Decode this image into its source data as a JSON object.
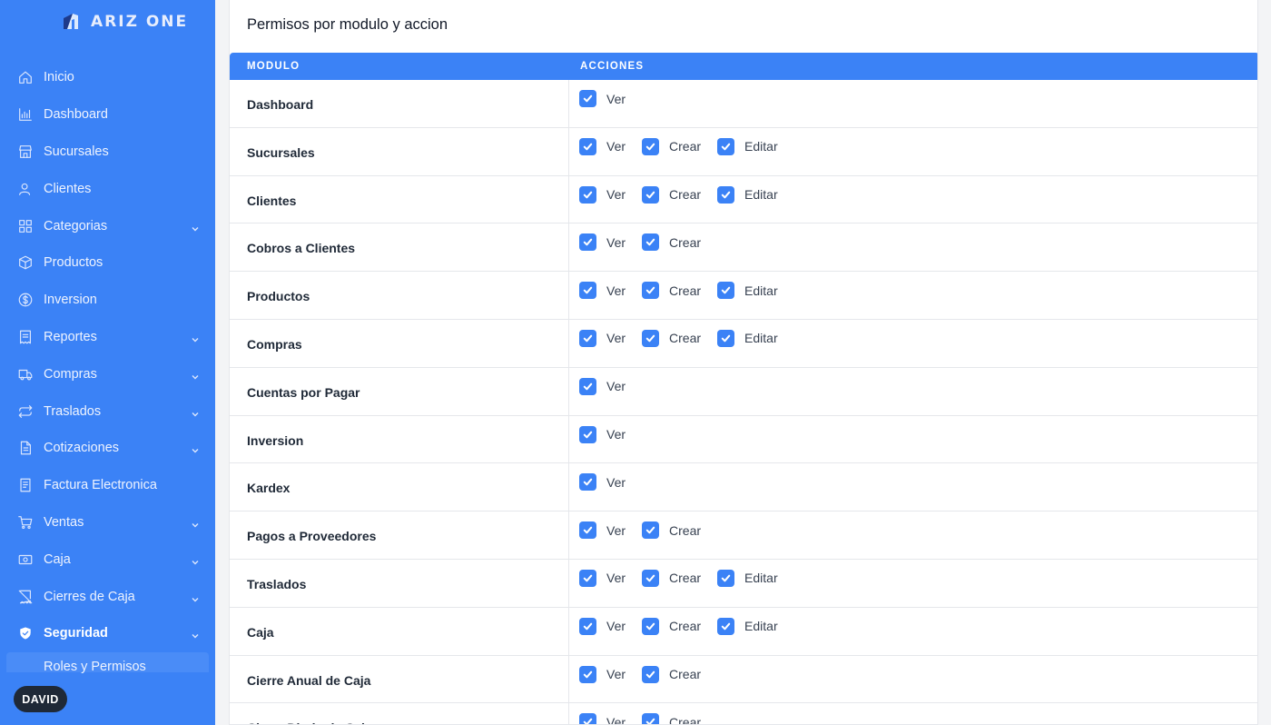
{
  "app": {
    "brand": "ARIZ ONE"
  },
  "sidebar": {
    "items": [
      {
        "label": "Inicio",
        "icon": "home-icon",
        "chevron": false
      },
      {
        "label": "Dashboard",
        "icon": "chart-icon",
        "chevron": false
      },
      {
        "label": "Sucursales",
        "icon": "store-icon",
        "chevron": false
      },
      {
        "label": "Clientes",
        "icon": "users-icon",
        "chevron": false
      },
      {
        "label": "Categorias",
        "icon": "grid-icon",
        "chevron": true
      },
      {
        "label": "Productos",
        "icon": "box-icon",
        "chevron": false
      },
      {
        "label": "Inversion",
        "icon": "dollar-icon",
        "chevron": false
      },
      {
        "label": "Reportes",
        "icon": "receipt-icon",
        "chevron": true
      },
      {
        "label": "Compras",
        "icon": "truck-icon",
        "chevron": true
      },
      {
        "label": "Traslados",
        "icon": "transfer-icon",
        "chevron": true
      },
      {
        "label": "Cotizaciones",
        "icon": "document-icon",
        "chevron": true
      },
      {
        "label": "Factura Electronica",
        "icon": "invoice-icon",
        "chevron": false
      },
      {
        "label": "Ventas",
        "icon": "cart-icon",
        "chevron": true
      },
      {
        "label": "Caja",
        "icon": "cash-icon",
        "chevron": true
      },
      {
        "label": "Cierres de Caja",
        "icon": "receipt-off-icon",
        "chevron": true
      },
      {
        "label": "Seguridad",
        "icon": "shield-icon",
        "chevron": true,
        "active": true
      }
    ],
    "sub_item": "Roles y Permisos",
    "user": "DAVID"
  },
  "main": {
    "title": "Permisos por modulo y accion",
    "columns": [
      "MODULO",
      "ACCIONES"
    ],
    "rows": [
      {
        "module": "Dashboard",
        "actions": [
          "Ver"
        ]
      },
      {
        "module": "Sucursales",
        "actions": [
          "Ver",
          "Crear",
          "Editar"
        ]
      },
      {
        "module": "Clientes",
        "actions": [
          "Ver",
          "Crear",
          "Editar"
        ]
      },
      {
        "module": "Cobros a Clientes",
        "actions": [
          "Ver",
          "Crear"
        ]
      },
      {
        "module": "Productos",
        "actions": [
          "Ver",
          "Crear",
          "Editar"
        ]
      },
      {
        "module": "Compras",
        "actions": [
          "Ver",
          "Crear",
          "Editar"
        ]
      },
      {
        "module": "Cuentas por Pagar",
        "actions": [
          "Ver"
        ]
      },
      {
        "module": "Inversion",
        "actions": [
          "Ver"
        ]
      },
      {
        "module": "Kardex",
        "actions": [
          "Ver"
        ]
      },
      {
        "module": "Pagos a Proveedores",
        "actions": [
          "Ver",
          "Crear"
        ]
      },
      {
        "module": "Traslados",
        "actions": [
          "Ver",
          "Crear",
          "Editar"
        ]
      },
      {
        "module": "Caja",
        "actions": [
          "Ver",
          "Crear",
          "Editar"
        ]
      },
      {
        "module": "Cierre Anual de Caja",
        "actions": [
          "Ver",
          "Crear"
        ]
      },
      {
        "module": "Cierre Diario de Caja",
        "actions": [
          "Ver",
          "Crear"
        ]
      }
    ]
  },
  "colors": {
    "primary": "#3b82f6",
    "sidebar_bg": "#3b82f6",
    "badge_bg": "#1f2937"
  }
}
